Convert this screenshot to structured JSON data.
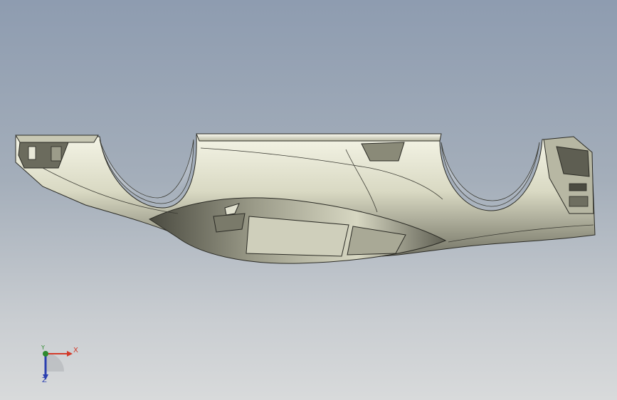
{
  "viewport": {
    "background_top": "#8e9cb0",
    "background_bottom": "#d8dadb"
  },
  "model": {
    "icon": "dashboard-panel-model",
    "body_color": "#e6e6d2",
    "shade_color": "#5b5b4f",
    "edge_color": "#2a2a24"
  },
  "triad": {
    "x_label": "X",
    "y_label": "Y",
    "z_label": "Z",
    "x_color": "#d23a2a",
    "y_color": "#2f8a2f",
    "z_color": "#2a3fb0"
  }
}
